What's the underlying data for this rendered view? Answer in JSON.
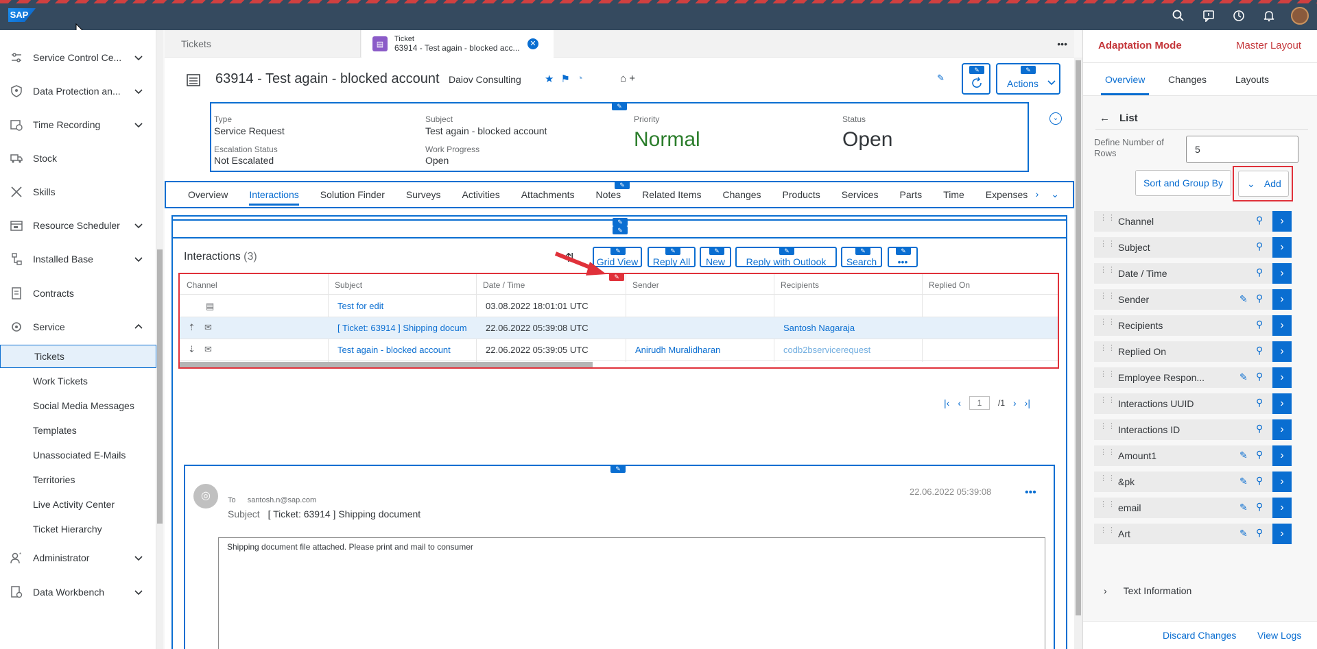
{
  "shell": {
    "logo": "SAP",
    "icons": [
      "search-icon",
      "feedback-icon",
      "history-icon",
      "notification-icon",
      "user-avatar"
    ]
  },
  "sidebar": {
    "items": [
      {
        "label": "Service Control Ce...",
        "icon": "control-center-icon",
        "expanded": false
      },
      {
        "label": "Data Protection an...",
        "icon": "shield-icon",
        "expanded": false
      },
      {
        "label": "Time Recording",
        "icon": "calendar-clock-icon",
        "expanded": false
      },
      {
        "label": "Stock",
        "icon": "truck-icon"
      },
      {
        "label": "Skills",
        "icon": "tools-icon"
      },
      {
        "label": "Resource Scheduler",
        "icon": "scheduler-icon",
        "expanded": false
      },
      {
        "label": "Installed Base",
        "icon": "hierarchy-icon",
        "expanded": false
      },
      {
        "label": "Contracts",
        "icon": "document-icon"
      },
      {
        "label": "Service",
        "icon": "wrench-icon",
        "expanded": true
      }
    ],
    "sub_items": [
      "Tickets",
      "Work Tickets",
      "Social Media Messages",
      "Templates",
      "Unassociated E-Mails",
      "Territories",
      "Live Activity Center",
      "Ticket Hierarchy"
    ],
    "active_sub": "Tickets",
    "bottom_items": [
      {
        "label": "Administrator",
        "icon": "admin-icon"
      },
      {
        "label": "Data Workbench",
        "icon": "workbench-icon"
      }
    ]
  },
  "tabs": {
    "tickets_label": "Tickets",
    "ticket_tab_type": "Ticket",
    "ticket_tab_title": "63914 - Test again - blocked acc..."
  },
  "header": {
    "title": "63914 - Test again - blocked account",
    "account": "Daiov Consulting",
    "actions_label": "Actions",
    "fields": {
      "type_label": "Type",
      "type_value": "Service Request",
      "subject_label": "Subject",
      "subject_value": "Test again - blocked account",
      "priority_label": "Priority",
      "priority_value": "Normal",
      "status_label": "Status",
      "status_value": "Open",
      "escalation_label": "Escalation Status",
      "escalation_value": "Not Escalated",
      "progress_label": "Work Progress",
      "progress_value": "Open"
    },
    "priority_color": "#2b7d2b"
  },
  "subtabs": [
    "Overview",
    "Interactions",
    "Solution Finder",
    "Surveys",
    "Activities",
    "Attachments",
    "Notes",
    "Related Items",
    "Changes",
    "Products",
    "Services",
    "Parts",
    "Time",
    "Expenses"
  ],
  "selected_subtab": "Interactions",
  "interactions": {
    "title": "Interactions",
    "count": "(3)",
    "buttons": [
      "Grid View",
      "Reply All",
      "New",
      "Reply with Outlook",
      "Search"
    ],
    "columns": [
      "Channel",
      "Subject",
      "Date / Time",
      "Sender",
      "Recipients",
      "Replied On"
    ],
    "rows": [
      {
        "channel_icons": [
          "note-icon"
        ],
        "subject": "Test for edit",
        "datetime": "03.08.2022 18:01:01 UTC",
        "sender": "",
        "recipients": "",
        "replied_on": ""
      },
      {
        "channel_icons": [
          "outbound-icon",
          "email-icon"
        ],
        "subject": "[ Ticket: 63914 ] Shipping docum",
        "datetime": "22.06.2022 05:39:08 UTC",
        "sender": "",
        "recipients": "Santosh Nagaraja",
        "replied_on": ""
      },
      {
        "channel_icons": [
          "inbound-icon",
          "email-icon"
        ],
        "subject": "Test again - blocked account",
        "datetime": "22.06.2022 05:39:05 UTC",
        "sender": "Anirudh Muralidharan",
        "recipients": "codb2bservicerequest",
        "replied_on": ""
      }
    ],
    "pager": {
      "page": "1",
      "total": "/1"
    }
  },
  "message": {
    "to_label": "To",
    "to_address": "santosh.n@sap.com",
    "subject_label": "Subject",
    "subject": "[ Ticket: 63914 ] Shipping document",
    "date": "22.06.2022 05:39:08",
    "body": "Shipping document file attached. Please print and mail to consumer"
  },
  "panel": {
    "title": "Adaptation Mode",
    "layout": "Master Layout",
    "tabs": [
      "Overview",
      "Changes",
      "Layouts"
    ],
    "selected_tab": "Overview",
    "back_label": "List",
    "rows_label": "Define Number of Rows",
    "rows_value": "5",
    "sort_label": "Sort and Group By",
    "add_label": "Add",
    "fields": [
      {
        "name": "Channel",
        "editable": false
      },
      {
        "name": "Subject",
        "editable": false
      },
      {
        "name": "Date / Time",
        "editable": false
      },
      {
        "name": "Sender",
        "editable": true
      },
      {
        "name": "Recipients",
        "editable": false
      },
      {
        "name": "Replied On",
        "editable": false
      },
      {
        "name": "Employee Respon...",
        "editable": true
      },
      {
        "name": "Interactions UUID",
        "editable": false
      },
      {
        "name": "Interactions ID",
        "editable": false
      },
      {
        "name": "Amount1",
        "editable": true
      },
      {
        "name": "&pk",
        "editable": true
      },
      {
        "name": "email",
        "editable": true
      },
      {
        "name": "Art",
        "editable": true
      }
    ],
    "text_info": "Text Information",
    "discard": "Discard Changes",
    "view_logs": "View Logs"
  }
}
